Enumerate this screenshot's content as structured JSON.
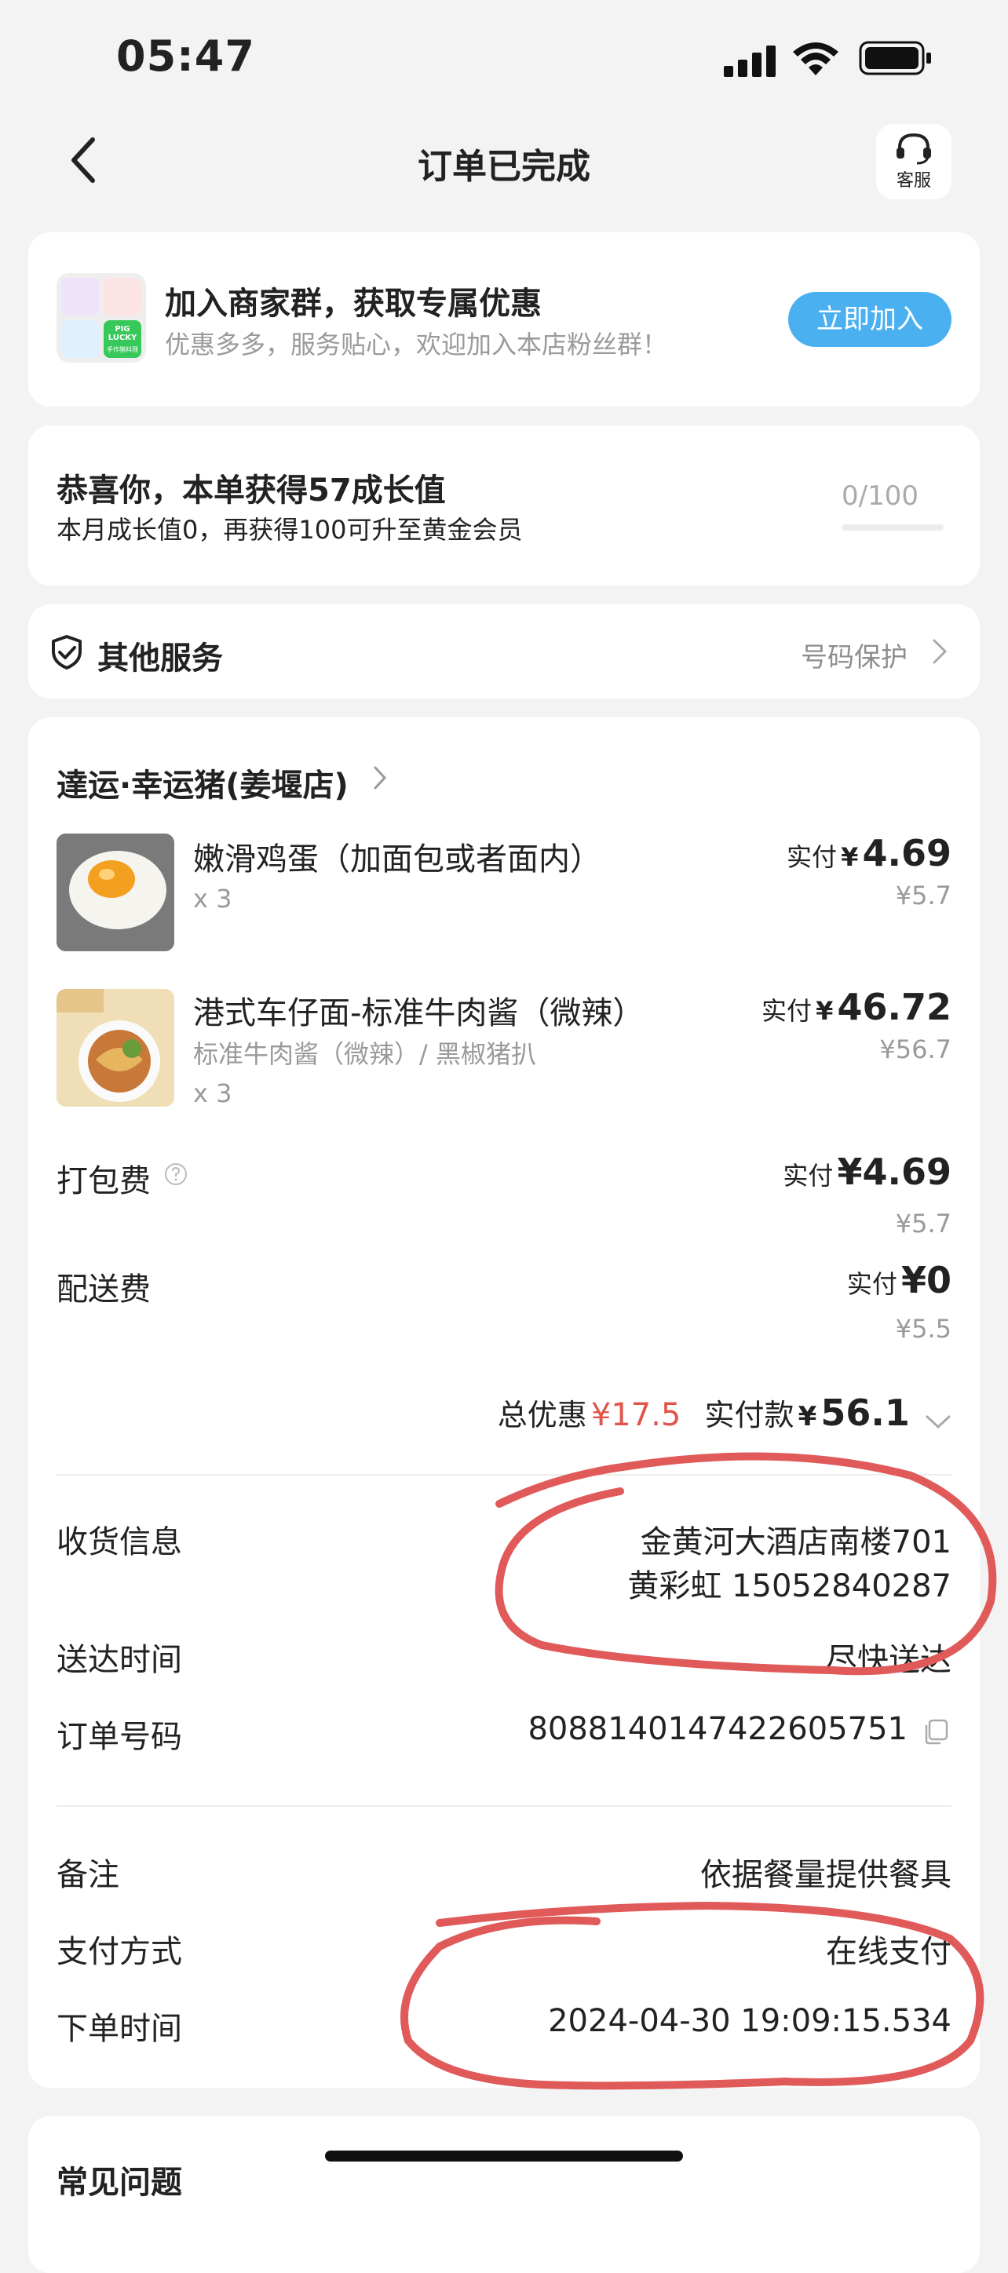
{
  "status_bar": {
    "time": "05:47"
  },
  "header": {
    "title": "订单已完成",
    "service_label": "客服"
  },
  "merchant_group": {
    "thumb_label": "PIG LUCKY",
    "thumb_caption": "手作猪料理",
    "title": "加入商家群，获取专属优惠",
    "subtitle": "优惠多多，服务贴心，欢迎加入本店粉丝群！",
    "join_button": "立即加入"
  },
  "growth": {
    "title": "恭喜你，本单获得57成长值",
    "subtitle": "本月成长值0，再获得100可升至黄金会员",
    "progress_text": "0/100",
    "progress_fraction": 0
  },
  "other_services": {
    "label": "其他服务",
    "value": "号码保护"
  },
  "order": {
    "shop_name": "達运·幸运猪(姜堰店)",
    "items": [
      {
        "name": "嫩滑鸡蛋（加面包或者面内）",
        "spec": "",
        "qty": "x 3",
        "paid_label": "实付",
        "currency": "¥",
        "paid": "4.69",
        "original": "¥5.7"
      },
      {
        "name": "港式车仔面-标准牛肉酱（微辣）",
        "spec": "标准牛肉酱（微辣）/ 黑椒猪扒",
        "qty": "x 3",
        "paid_label": "实付",
        "currency": "¥",
        "paid": "46.72",
        "original": "¥56.7"
      }
    ],
    "packing_fee": {
      "label": "打包费",
      "paid_label": "实付",
      "paid": "¥4.69",
      "original": "¥5.7"
    },
    "delivery_fee": {
      "label": "配送费",
      "paid_label": "实付",
      "paid": "¥0",
      "original": "¥5.5"
    },
    "total_discount_label": "总优惠",
    "total_discount": "¥17.5",
    "total_paid_label": "实付款",
    "total_paid_currency": "¥",
    "total_paid": "56.1",
    "accent_color": "#e0544a"
  },
  "details": {
    "receiver_label": "收货信息",
    "receiver_address": "金黄河大酒店南楼701",
    "receiver_contact": "黄彩虹 15052840287",
    "delivery_time_label": "送达时间",
    "delivery_time": "尽快送达",
    "order_no_label": "订单号码",
    "order_no": "8088140147422605751",
    "remark_label": "备注",
    "remark": "依据餐量提供餐具",
    "payment_label": "支付方式",
    "payment": "在线支付",
    "order_time_label": "下单时间",
    "order_time": "2024-04-30 19:09:15.534"
  },
  "faq": {
    "title": "常见问题"
  }
}
